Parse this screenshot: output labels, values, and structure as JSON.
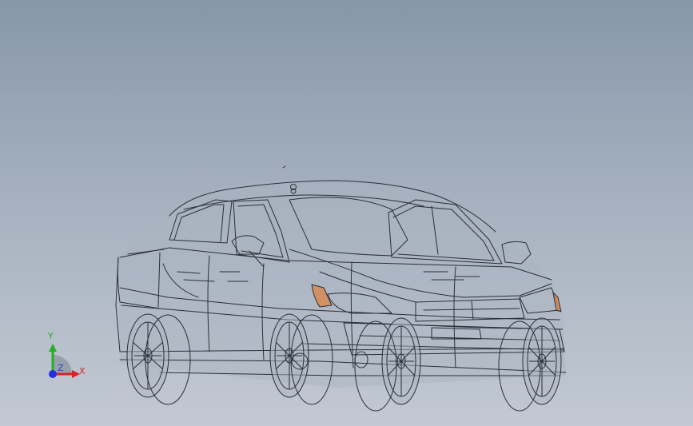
{
  "triad": {
    "x_label": "X",
    "y_label": "Y",
    "z_label": "Z",
    "x_color": "#e02020",
    "y_color": "#20b020",
    "z_color": "#2030e0"
  },
  "model": {
    "render_mode": "wireframe",
    "accent_color": "#d98a55"
  }
}
